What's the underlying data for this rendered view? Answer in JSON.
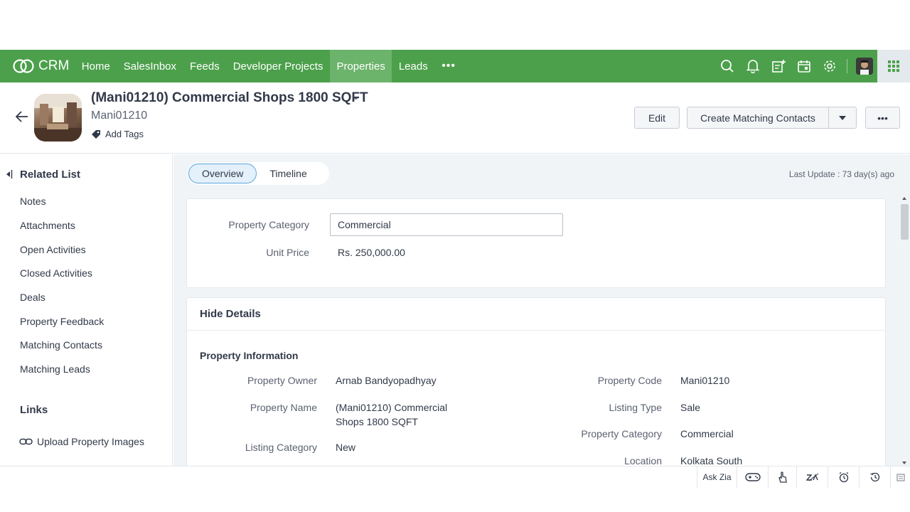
{
  "topbar": {
    "brand": "CRM",
    "nav": [
      "Home",
      "SalesInbox",
      "Feeds",
      "Developer Projects",
      "Properties",
      "Leads"
    ],
    "active_nav": "Properties",
    "more": "•••",
    "colors": {
      "bar": "#4ca04b",
      "active": "#6cb36b"
    },
    "icons": [
      "search-icon",
      "bell-icon",
      "add-note-icon",
      "calendar-icon",
      "gear-icon",
      "avatar",
      "apps-grid-icon"
    ]
  },
  "record": {
    "title": "(Mani01210) Commercial Shops 1800 SQFT",
    "dash": "-",
    "subtitle": "Mani01210",
    "tags_label": "Add Tags"
  },
  "actions": {
    "edit": "Edit",
    "create_matching": "Create Matching Contacts",
    "more": "•••"
  },
  "sidebar": {
    "related_title": "Related List",
    "items": [
      "Notes",
      "Attachments",
      "Open Activities",
      "Closed Activities",
      "Deals",
      "Property Feedback",
      "Matching Contacts",
      "Matching Leads"
    ],
    "links_title": "Links",
    "link_item": "Upload Property Images"
  },
  "tabs": {
    "overview": "Overview",
    "timeline": "Timeline"
  },
  "last_update": "Last Update : 73 day(s) ago",
  "summary": {
    "category_label": "Property Category",
    "category_value": "Commercial",
    "price_label": "Unit Price",
    "price_value": "Rs. 250,000.00"
  },
  "details": {
    "toggle": "Hide Details",
    "section": "Property Information",
    "left": [
      {
        "label": "Property Owner",
        "value": "Arnab Bandyopadhyay"
      },
      {
        "label": "Property Name",
        "value": "(Mani01210) Commercial",
        "value2": "Shops 1800 SQFT"
      },
      {
        "label": "Listing Category",
        "value": "New"
      }
    ],
    "right": [
      {
        "label": "Property Code",
        "value": "Mani01210"
      },
      {
        "label": "Listing Type",
        "value": "Sale"
      },
      {
        "label": "Property Category",
        "value": "Commercial"
      },
      {
        "label": "Location",
        "value": "Kolkata South"
      }
    ]
  },
  "footer": {
    "ask_zia": "Ask Zia"
  }
}
